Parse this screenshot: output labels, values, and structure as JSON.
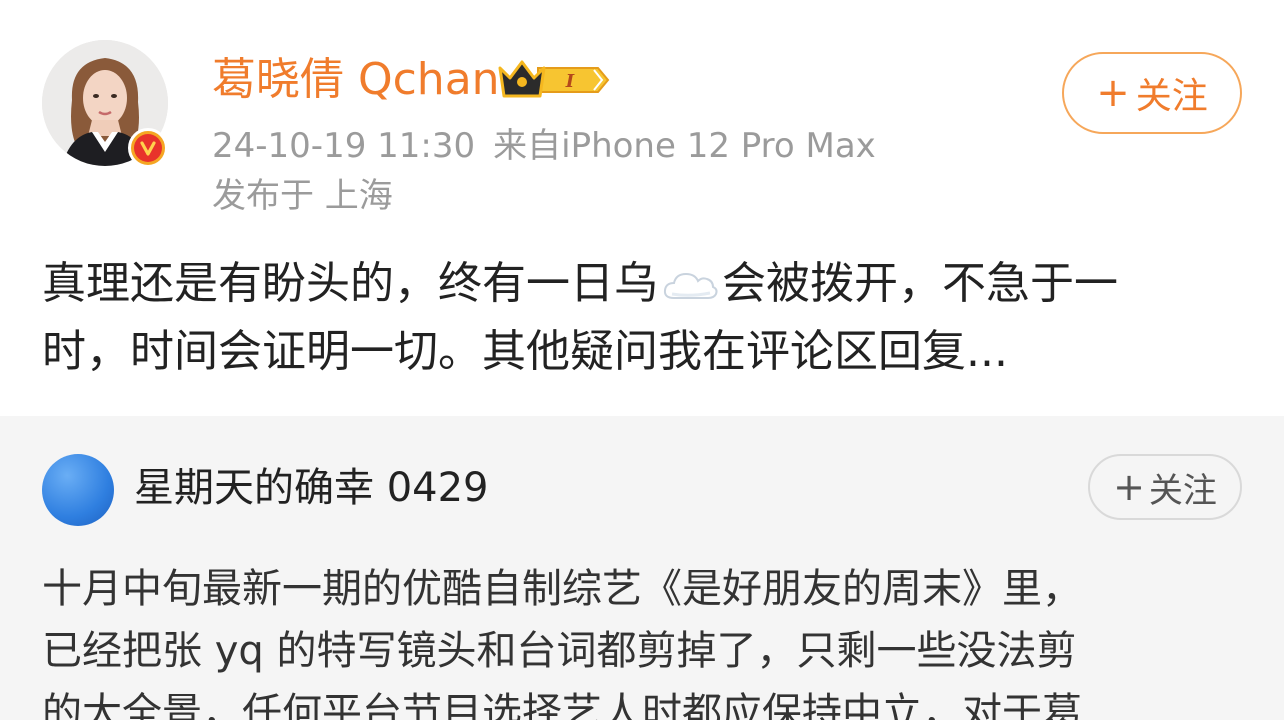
{
  "post": {
    "username": "葛晓倩 Qchan",
    "badge_level": "I",
    "timestamp": "24-10-19 11:30",
    "source": "来自iPhone 12 Pro Max",
    "location": "发布于 上海",
    "follow_label": "关注",
    "follow_plus": "+",
    "text_line1_before_emoji": "真理还是有盼头的，终有一日乌",
    "text_line1_after_emoji": "会被拨开，不急于一",
    "text_line2": "时，时间会证明一切。其他疑问我在评论区回复...",
    "emoji": "cloud-icon"
  },
  "repost": {
    "username": "星期天的确幸 0429",
    "follow_label": "关注",
    "follow_plus": "+",
    "text_lines": [
      "十月中旬最新一期的优酷自制综艺《是好朋友的周末》里，",
      "已经把张 yq 的特写镜头和台词都剪掉了，只剩一些没法剪",
      "的大全景，任何平台节目选择艺人时都应保持中立，对于葛"
    ]
  },
  "colors": {
    "accent": "#f07c2c",
    "meta_gray": "#9b9b9b",
    "repost_bg": "#f5f5f5",
    "verified_outer": "#f5a623",
    "verified_inner": "#e8332b"
  }
}
